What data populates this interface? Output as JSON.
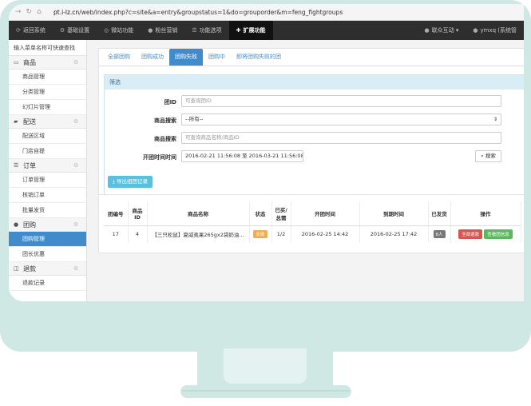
{
  "browser": {
    "nav_icons": [
      "back-arrow-icon",
      "forward-arrow-icon",
      "reload-icon",
      "home-icon"
    ],
    "url_host": "pt.i-lz.cn",
    "url_path": "/web/index.php?c=site&a=entry&groupstatus=1&do=grouporder&m=feng_fightgroups"
  },
  "topnav": {
    "items": [
      {
        "label": "返回系统",
        "icon": "refresh-icon"
      },
      {
        "label": "基础设置",
        "icon": "gear-icon"
      },
      {
        "label": "微站功能",
        "icon": "globe-icon"
      },
      {
        "label": "粉丝营销",
        "icon": "users-icon"
      },
      {
        "label": "功能选项",
        "icon": "list-icon"
      },
      {
        "label": "扩展功能",
        "icon": "puzzle-icon",
        "active": true
      }
    ],
    "account": "联众互动 ▾",
    "user": "ymxq (系统管"
  },
  "sidebar": {
    "search_placeholder": "输入菜单名称可快速查找",
    "groups": [
      {
        "name": "商品",
        "icon": "inbox-icon",
        "items": [
          "商品管理",
          "分类管理",
          "幻灯片管理"
        ]
      },
      {
        "name": "配送",
        "icon": "truck-icon",
        "items": [
          "配送区域",
          "门店自提"
        ]
      },
      {
        "name": "订单",
        "icon": "list-icon",
        "items": [
          "订单管理",
          "核销订单",
          "批量发货"
        ]
      },
      {
        "name": "团购",
        "icon": "users-icon",
        "items": [
          "团购管理",
          "团长优惠"
        ]
      },
      {
        "name": "退款",
        "icon": "refund-icon",
        "items": [
          "退款记录"
        ]
      }
    ],
    "active_item": "团购管理"
  },
  "tabs": [
    "全部团购",
    "团购成功",
    "团购失败",
    "团购中",
    "即将团购失败的团"
  ],
  "active_tab": "团购失败",
  "filter": {
    "title": "筛选",
    "group_id_label": "团ID",
    "group_id_placeholder": "可查询团ID",
    "product_search_label": "商品搜索",
    "product_search_value": "--所有--",
    "product_keyword_label": "商品搜索",
    "product_keyword_placeholder": "可查询商品名称/商品ID",
    "open_time_label": "开团时间时间",
    "open_time_value": "2016-02-21 11:56:08 至 2016-03-21 11:56:08",
    "search_button": "搜索",
    "export_button": "导出组团记录"
  },
  "table": {
    "headers": [
      "团编号",
      "商品ID",
      "商品名称",
      "状态",
      "已买/总需",
      "开团时间",
      "到期时间",
      "已发货",
      "操作"
    ],
    "rows": [
      {
        "group_no": "17",
        "product_id": "4",
        "product_name": "【三只松鼠】夏威夷果265gx2袋奶油...",
        "status": "失败",
        "bought_total": "1/2",
        "open_time": "2016-02-25 14:42",
        "expire_time": "2016-02-25 17:42",
        "shipped": "8人",
        "action_refund": "全部退款",
        "action_view": "查看团信息"
      }
    ]
  }
}
